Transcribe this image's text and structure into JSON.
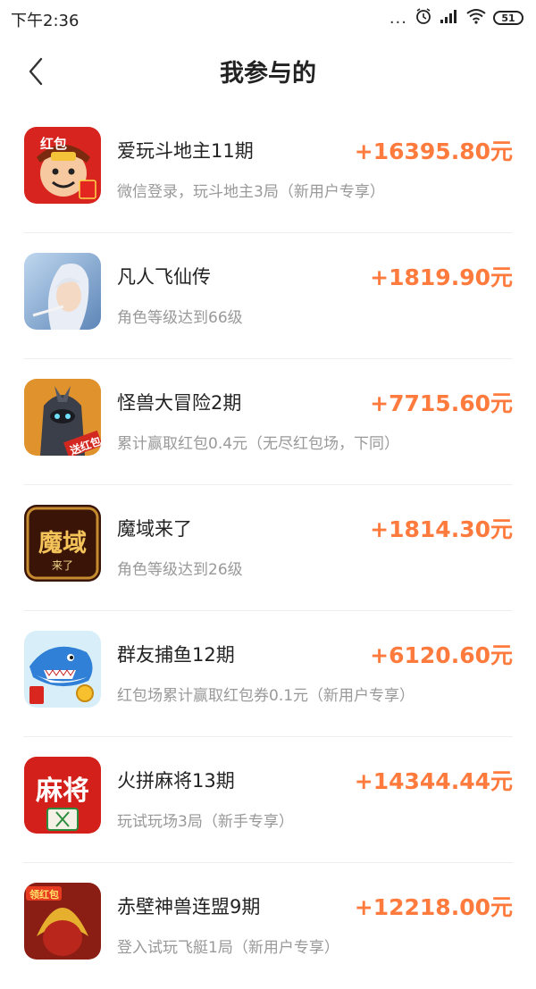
{
  "status_bar": {
    "time": "下午2:36",
    "dots": "...",
    "battery": "51",
    "icons": [
      "alarm-icon",
      "signal-icon",
      "wifi-icon",
      "battery-icon"
    ]
  },
  "header": {
    "title": "我参与的",
    "back_icon": "chevron-left-icon"
  },
  "colors": {
    "amount": "#ff7a3d",
    "secondary_text": "#999999",
    "divider": "#eeeeee"
  },
  "items": [
    {
      "name": "爱玩斗地主11期",
      "amount": "+16395.80元",
      "desc": "微信登录，玩斗地主3局（新用户专享）",
      "icon": "doudizhu-game-icon",
      "icon_text": "红包"
    },
    {
      "name": "凡人飞仙传",
      "amount": "+1819.90元",
      "desc": "角色等级达到66级",
      "icon": "fanren-feixian-game-icon",
      "icon_text": ""
    },
    {
      "name": "怪兽大冒险2期",
      "amount": "+7715.60元",
      "desc": "累计赢取红包0.4元（无尽红包场，下同）",
      "icon": "monster-adventure-game-icon",
      "icon_text": "送红包"
    },
    {
      "name": "魔域来了",
      "amount": "+1814.30元",
      "desc": "角色等级达到26级",
      "icon": "moyu-game-icon",
      "icon_text": "魔域",
      "icon_subtext": "来了"
    },
    {
      "name": "群友捕鱼12期",
      "amount": "+6120.60元",
      "desc": "红包场累计赢取红包券0.1元（新用户专享）",
      "icon": "fishing-shark-game-icon",
      "icon_text": ""
    },
    {
      "name": "火拼麻将13期",
      "amount": "+14344.44元",
      "desc": "玩试玩场3局（新手专享）",
      "icon": "mahjong-game-icon",
      "icon_text": "麻将"
    },
    {
      "name": "赤壁神兽连盟9期",
      "amount": "+12218.00元",
      "desc": "登入试玩飞艇1局（新用户专享）",
      "icon": "chibi-beast-game-icon",
      "icon_text": "领红包"
    }
  ]
}
